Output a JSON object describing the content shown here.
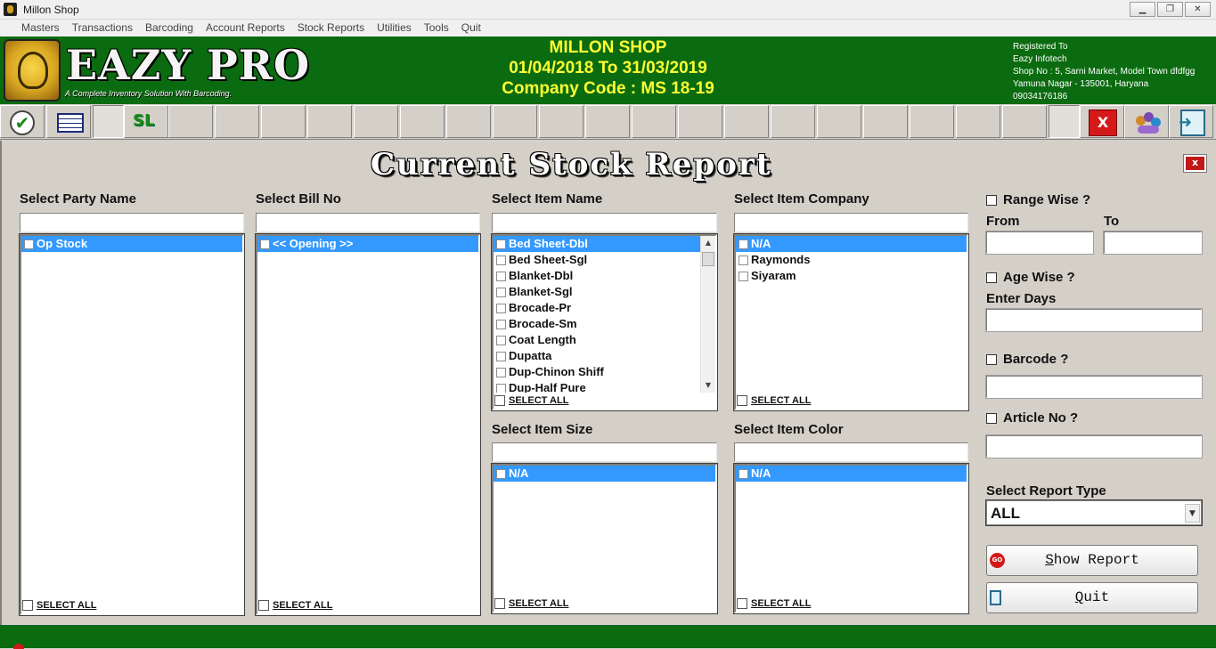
{
  "window": {
    "title": "Millon Shop",
    "controls": [
      "▁",
      "❐",
      "✕"
    ]
  },
  "menu": [
    "Masters",
    "Transactions",
    "Barcoding",
    "Account Reports",
    "Stock Reports",
    "Utilities",
    "Tools",
    "Quit"
  ],
  "header": {
    "logo_text": "EAZY PRO",
    "logo_subtitle": "A Complete Inventory Solution With Barcoding.",
    "shop_name": "MILLON SHOP",
    "period": "01/04/2018 To 31/03/2019",
    "company_code": "Company Code : MS 18-19",
    "registration": [
      "Registered To",
      "Eazy Infotech",
      "Shop No : 5, Sarni Market, Model Town dfdfgg",
      "Yamuna Nagar - 135001, Haryana",
      "09034176186"
    ]
  },
  "toolbar": {
    "check_glyph": "✔",
    "sl_label": "SL",
    "close_glyph": "X"
  },
  "form": {
    "title": "Current Stock Report",
    "close_glyph": "x",
    "party": {
      "label": "Select Party Name",
      "items": [
        "Op Stock"
      ],
      "select_all": "SELECT ALL"
    },
    "bill": {
      "label": "Select Bill No",
      "items": [
        "<< Opening >>"
      ],
      "select_all": "SELECT ALL"
    },
    "item": {
      "label": "Select Item Name",
      "items": [
        "Bed Sheet-Dbl",
        "Bed Sheet-Sgl",
        "Blanket-Dbl",
        "Blanket-Sgl",
        "Brocade-Pr",
        "Brocade-Sm",
        "Coat Length",
        "Dupatta",
        "Dup-Chinon Shiff",
        "Dup-Half Pure"
      ],
      "select_all": "SELECT ALL"
    },
    "company": {
      "label": "Select Item Company",
      "items": [
        "N/A",
        "Raymonds",
        "Siyaram"
      ],
      "select_all": "SELECT ALL"
    },
    "size": {
      "label": "Select Item Size",
      "items": [
        "N/A"
      ],
      "select_all": "SELECT ALL"
    },
    "color": {
      "label": "Select Item Color",
      "items": [
        "N/A"
      ],
      "select_all": "SELECT ALL"
    },
    "range_wise": "Range Wise ?",
    "from": "From",
    "to": "To",
    "age_wise": "Age Wise ?",
    "enter_days": "Enter Days",
    "barcode": "Barcode ?",
    "article_no": "Article No ?",
    "report_type_label": "Select Report Type",
    "report_type_value": "ALL",
    "show_report": {
      "first": "S",
      "rest": "how Report",
      "icon": "GO"
    },
    "quit": {
      "first": "Q",
      "rest": "uit"
    }
  },
  "colors": {
    "header_green": "#0b6b10",
    "header_yellow": "#ffff33",
    "selection_blue": "#3399ff",
    "close_red": "#d51818"
  }
}
